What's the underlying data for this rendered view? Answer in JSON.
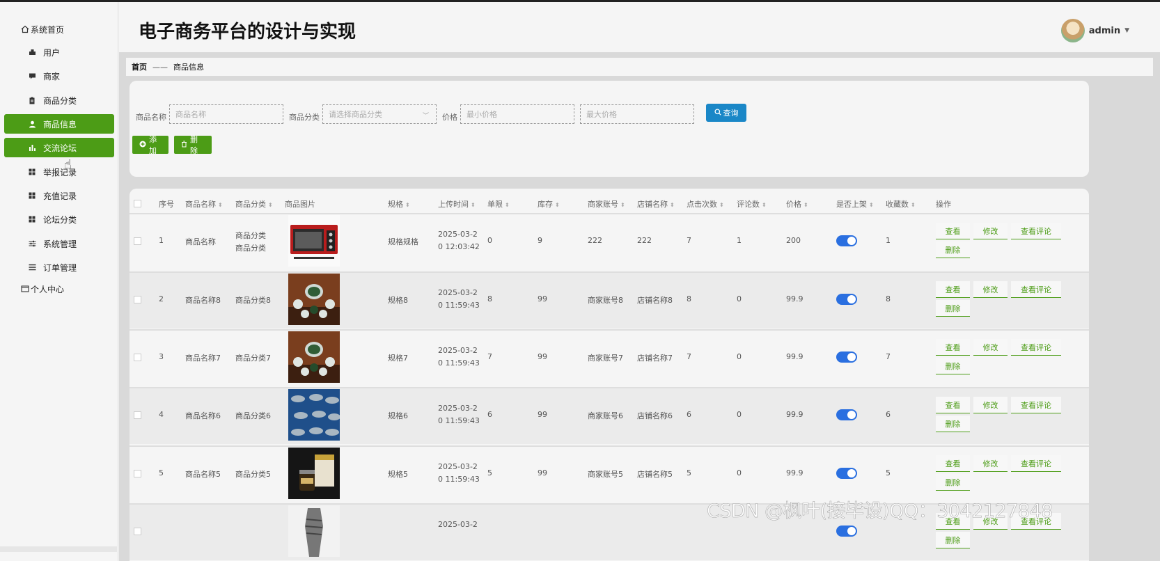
{
  "app": {
    "title": "电子商务平台的设计与实现",
    "user": "admin"
  },
  "sidebar": {
    "home": "系统首页",
    "items": [
      {
        "label": "用户",
        "icon": "user-group-icon"
      },
      {
        "label": "商家",
        "icon": "chat-icon"
      },
      {
        "label": "商品分类",
        "icon": "clipboard-icon"
      },
      {
        "label": "商品信息",
        "icon": "person-icon"
      },
      {
        "label": "交流论坛",
        "icon": "bar-chart-icon"
      },
      {
        "label": "举报记录",
        "icon": "grid-icon"
      },
      {
        "label": "充值记录",
        "icon": "grid-icon"
      },
      {
        "label": "论坛分类",
        "icon": "grid-icon"
      },
      {
        "label": "系统管理",
        "icon": "sliders-icon"
      },
      {
        "label": "订单管理",
        "icon": "list-icon"
      }
    ],
    "personal": "个人中心"
  },
  "breadcrumb": {
    "home": "首页",
    "sep": "——",
    "current": "商品信息"
  },
  "filter": {
    "name_label": "商品名称",
    "name_placeholder": "商品名称",
    "cat_label": "商品分类",
    "cat_placeholder": "请选择商品分类",
    "price_label": "价格",
    "min_placeholder": "最小价格",
    "max_placeholder": "最大价格",
    "query_btn": "查询",
    "add_btn": "添加",
    "delete_btn": "删除"
  },
  "table": {
    "headers": [
      "序号",
      "商品名称",
      "商品分类",
      "商品图片",
      "规格",
      "上传时间",
      "单限",
      "库存",
      "商家账号",
      "店铺名称",
      "点击次数",
      "评论数",
      "价格",
      "是否上架",
      "收藏数",
      "操作"
    ],
    "actions": {
      "view": "查看",
      "edit": "修改",
      "comments": "查看评论",
      "delete": "删除"
    },
    "rows": [
      {
        "no": "1",
        "name": "商品名称",
        "cat1": "商品分类",
        "cat2": "商品分类",
        "img": "oven",
        "spec": "规格规格",
        "t1": "2025-03-2",
        "t2": "0 12:03:42",
        "limit": "0",
        "stock": "9",
        "account": "222",
        "shop": "222",
        "clicks": "7",
        "comments": "1",
        "price": "200",
        "fav": "1"
      },
      {
        "no": "2",
        "name": "商品名称8",
        "cat1": "商品分类8",
        "cat2": "",
        "img": "teaset",
        "spec": "规格8",
        "t1": "2025-03-2",
        "t2": "0 11:59:43",
        "limit": "8",
        "stock": "99",
        "account": "商家账号8",
        "shop": "店铺名称8",
        "clicks": "8",
        "comments": "0",
        "price": "99.9",
        "fav": "8"
      },
      {
        "no": "3",
        "name": "商品名称7",
        "cat1": "商品分类7",
        "cat2": "",
        "img": "teaset",
        "spec": "规格7",
        "t1": "2025-03-2",
        "t2": "0 11:59:43",
        "limit": "7",
        "stock": "99",
        "account": "商家账号7",
        "shop": "店铺名称7",
        "clicks": "7",
        "comments": "0",
        "price": "99.9",
        "fav": "7"
      },
      {
        "no": "4",
        "name": "商品名称6",
        "cat1": "商品分类6",
        "cat2": "",
        "img": "fish",
        "spec": "规格6",
        "t1": "2025-03-2",
        "t2": "0 11:59:43",
        "limit": "6",
        "stock": "99",
        "account": "商家账号6",
        "shop": "店铺名称6",
        "clicks": "6",
        "comments": "0",
        "price": "99.9",
        "fav": "6"
      },
      {
        "no": "5",
        "name": "商品名称5",
        "cat1": "商品分类5",
        "cat2": "",
        "img": "jar",
        "spec": "规格5",
        "t1": "2025-03-2",
        "t2": "0 11:59:43",
        "limit": "5",
        "stock": "99",
        "account": "商家账号5",
        "shop": "店铺名称5",
        "clicks": "5",
        "comments": "0",
        "price": "99.9",
        "fav": "5"
      },
      {
        "no": "",
        "name": "",
        "cat1": "",
        "cat2": "",
        "img": "dress",
        "spec": "",
        "t1": "2025-03-2",
        "t2": "",
        "limit": "",
        "stock": "",
        "account": "",
        "shop": "",
        "clicks": "",
        "comments": "",
        "price": "",
        "fav": ""
      }
    ]
  },
  "watermark": "CSDN @枫叶(接毕设)QQ：3042127848",
  "colors": {
    "accent_green": "#4c9c16",
    "query_blue": "#1a87c7",
    "toggle_blue": "#2a6fe0"
  }
}
